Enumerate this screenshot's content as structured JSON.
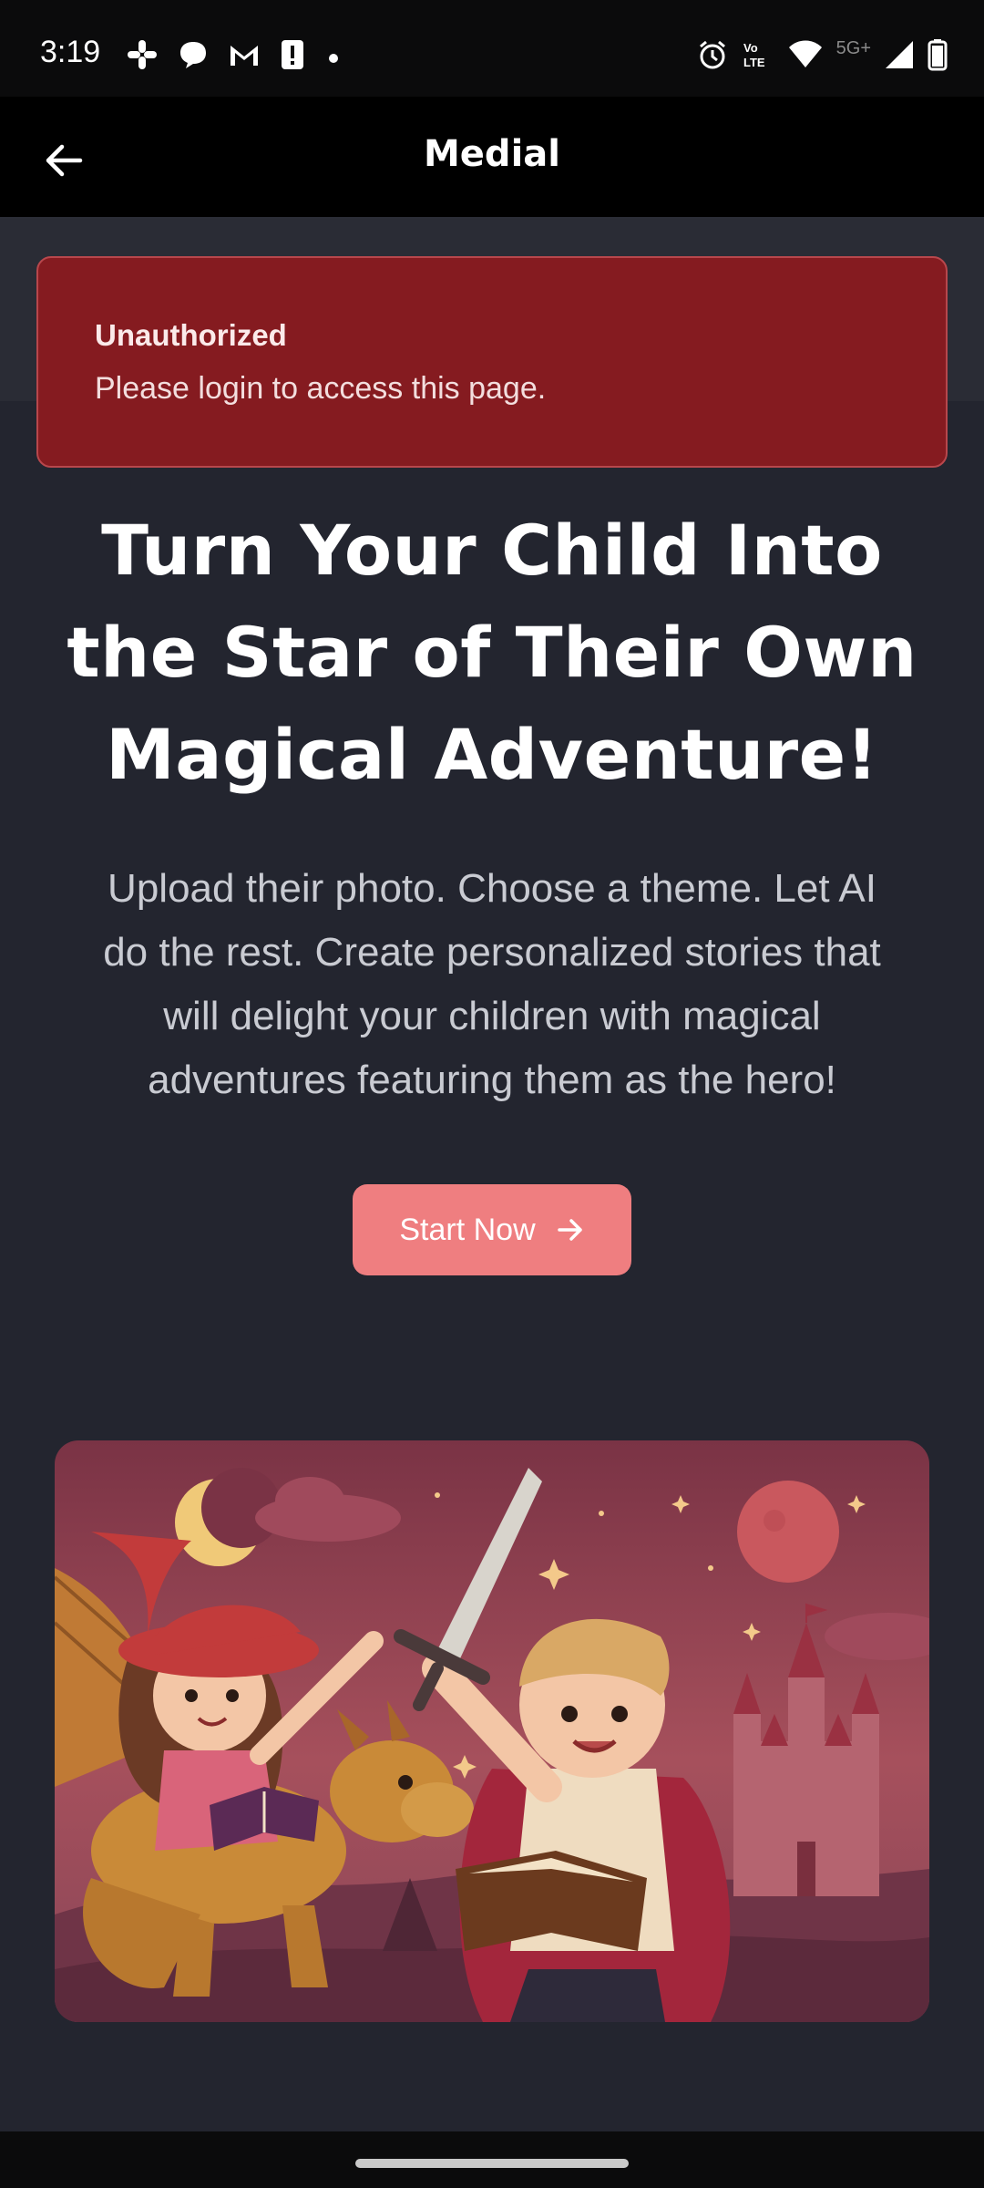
{
  "status_bar": {
    "time": "3:19",
    "network": "5G+",
    "left_icons": [
      "slack-icon",
      "chat-bubble-icon",
      "gmail-icon",
      "alert-icon",
      "dot-icon"
    ],
    "right_icons": [
      "alarm-icon",
      "volte-icon",
      "wifi-icon",
      "signal-icon",
      "battery-icon"
    ]
  },
  "app_bar": {
    "title": "Medial",
    "back_icon": "arrow-left-icon"
  },
  "alert": {
    "title": "Unauthorized",
    "message": "Please login to access this page.",
    "color": "#851b20"
  },
  "hero": {
    "title_lines": [
      "Turn Your Child Into",
      "the Star of Their Own",
      "Magical Adventure!"
    ],
    "description_lines": [
      "Upload their photo. Choose a theme. Let AI",
      "do the rest. Create personalized stories that",
      "will delight your children with magical",
      "adventures featuring them as the hero!"
    ],
    "cta_label": "Start Now",
    "cta_icon": "arrow-right-icon",
    "cta_color": "#ef7e80"
  },
  "illustration": {
    "subject": "girl-on-dragon-and-boy-with-sword-illustration"
  }
}
